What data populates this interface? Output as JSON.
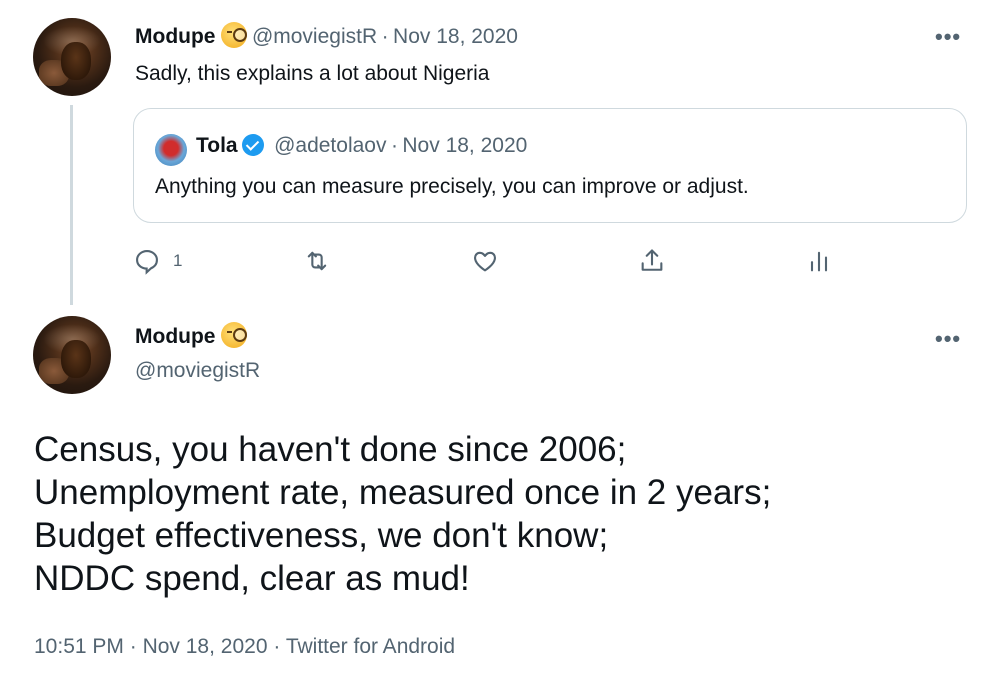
{
  "thread_tweet": {
    "author_name": "Modupe",
    "emoji": "monocle-face-emoji",
    "handle": "@moviegistR",
    "separator": "·",
    "date": "Nov 18, 2020",
    "text": "Sadly, this explains a lot about Nigeria",
    "more": "•••",
    "quoted": {
      "author_name": "Tola",
      "handle": "@adetolaov",
      "separator": "·",
      "date": "Nov 18, 2020",
      "text": "Anything you can measure precisely, you can improve or adjust."
    },
    "actions": {
      "reply_count": "1",
      "icons": [
        "reply-icon",
        "retweet-icon",
        "like-icon",
        "share-icon",
        "analytics-icon"
      ]
    }
  },
  "main_tweet": {
    "author_name": "Modupe",
    "handle": "@moviegistR",
    "more": "•••",
    "lines": [
      "Census, you haven't done since 2006;",
      "Unemployment rate, measured once in 2 years;",
      "Budget effectiveness, we don't know;",
      "NDDC spend, clear as mud!"
    ],
    "time": "10:51 PM",
    "separator": "·",
    "date": "Nov 18, 2020",
    "source": "Twitter for Android"
  },
  "colors": {
    "text": "#0f1419",
    "muted": "#536471",
    "border": "#cfd9de",
    "verified": "#1d9bf0"
  }
}
